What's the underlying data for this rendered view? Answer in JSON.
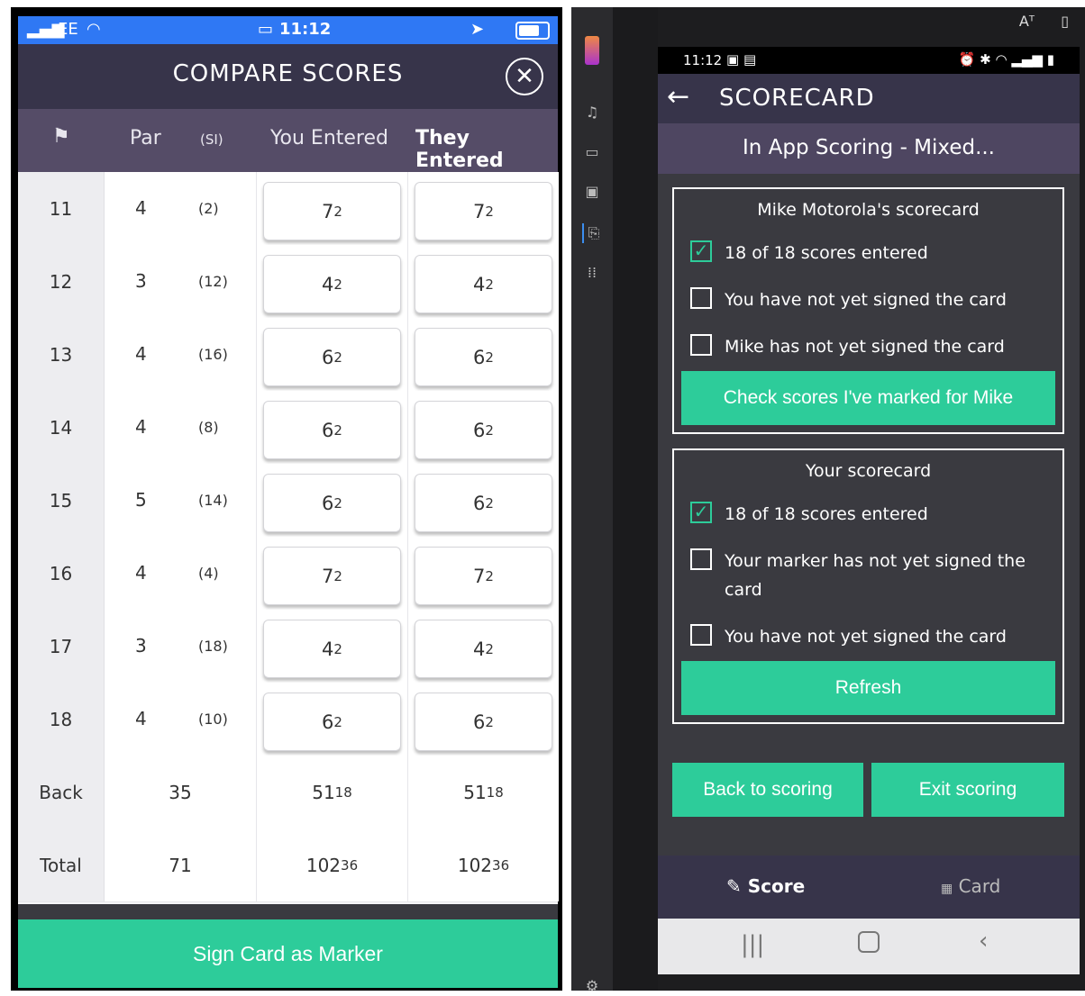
{
  "left": {
    "status": {
      "carrier": "EE",
      "time": "11:12"
    },
    "title": "COMPARE SCORES",
    "close_icon": "close-icon",
    "headers": {
      "flag_icon": "flag-icon",
      "par": "Par",
      "si": "(SI)",
      "you": "You Entered",
      "they": "They Entered"
    },
    "rows": [
      {
        "hole": "11",
        "par": "4",
        "si": "(2)",
        "you": "7",
        "you_sub": "2",
        "they": "7",
        "they_sub": "2"
      },
      {
        "hole": "12",
        "par": "3",
        "si": "(12)",
        "you": "4",
        "you_sub": "2",
        "they": "4",
        "they_sub": "2"
      },
      {
        "hole": "13",
        "par": "4",
        "si": "(16)",
        "you": "6",
        "you_sub": "2",
        "they": "6",
        "they_sub": "2"
      },
      {
        "hole": "14",
        "par": "4",
        "si": "(8)",
        "you": "6",
        "you_sub": "2",
        "they": "6",
        "they_sub": "2"
      },
      {
        "hole": "15",
        "par": "5",
        "si": "(14)",
        "you": "6",
        "you_sub": "2",
        "they": "6",
        "they_sub": "2"
      },
      {
        "hole": "16",
        "par": "4",
        "si": "(4)",
        "you": "7",
        "you_sub": "2",
        "they": "7",
        "they_sub": "2"
      },
      {
        "hole": "17",
        "par": "3",
        "si": "(18)",
        "you": "4",
        "you_sub": "2",
        "they": "4",
        "they_sub": "2"
      },
      {
        "hole": "18",
        "par": "4",
        "si": "(10)",
        "you": "6",
        "you_sub": "2",
        "they": "6",
        "they_sub": "2"
      }
    ],
    "back": {
      "label": "Back",
      "par": "35",
      "you": "51",
      "you_sub": "18",
      "they": "51",
      "they_sub": "18"
    },
    "total": {
      "label": "Total",
      "par": "71",
      "you": "102",
      "you_sub": "36",
      "they": "102",
      "they_sub": "36"
    },
    "sign_button": "Sign Card as Marker"
  },
  "right": {
    "status": {
      "time": "11:12"
    },
    "title": "SCORECARD",
    "subtitle": "In App Scoring - Mixed...",
    "card1": {
      "title": "Mike Motorola's scorecard",
      "items": [
        {
          "label": "18 of 18 scores entered",
          "checked": true
        },
        {
          "label": "You have not yet signed the card",
          "checked": false
        },
        {
          "label": "Mike has not yet signed the card",
          "checked": false
        }
      ],
      "button": "Check scores I've marked for Mike"
    },
    "card2": {
      "title": "Your scorecard",
      "items": [
        {
          "label": "18 of 18 scores entered",
          "checked": true
        },
        {
          "label": "Your marker has not yet signed the card",
          "checked": false
        },
        {
          "label": "You have not yet signed the card",
          "checked": false
        }
      ],
      "button": "Refresh"
    },
    "back_button": "Back to scoring",
    "exit_button": "Exit scoring",
    "tabs": {
      "score": "Score",
      "card": "Card"
    }
  },
  "colors": {
    "accent": "#2dcc9a",
    "header": "#37344a",
    "subheader": "#554c67",
    "ios_status": "#2f78f4"
  }
}
